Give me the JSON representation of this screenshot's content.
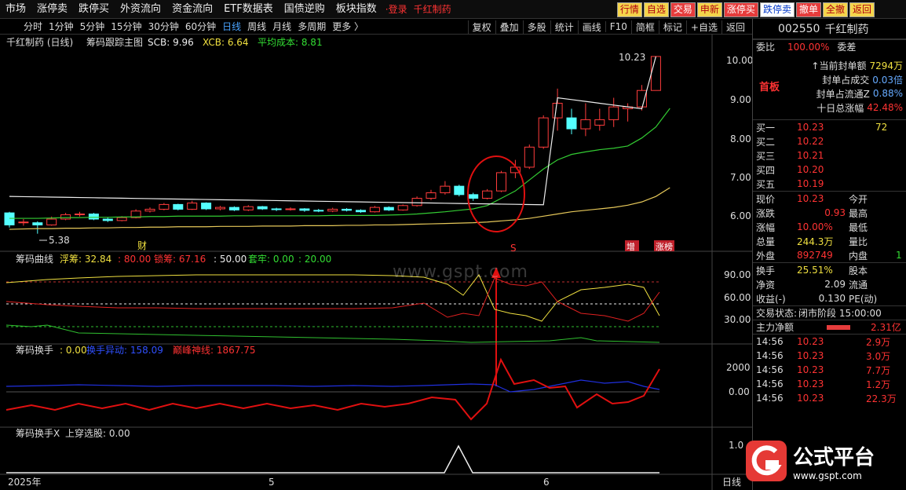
{
  "menubar": {
    "items": [
      "市场",
      "涨停卖",
      "跌停买",
      "外资流向",
      "资金流向",
      "ETF数据表",
      "国债逆购",
      "板块指数"
    ],
    "login": "·登录",
    "stock_name": "千红制药",
    "buttons": [
      "行情",
      "自选",
      "交易",
      "申新",
      "涨停买",
      "跌停卖",
      "撤单",
      "全撤",
      "返回"
    ]
  },
  "periodbar": {
    "periods": [
      "分时",
      "1分钟",
      "5分钟",
      "15分钟",
      "30分钟",
      "60分钟",
      "日线",
      "周线",
      "月线",
      "多周期",
      "更多 〉"
    ],
    "active": "日线",
    "tools": [
      "复权",
      "叠加",
      "多股",
      "统计",
      "画线",
      "F10",
      "简框",
      "标记",
      "+自选",
      "返回"
    ]
  },
  "main_panel": {
    "title": "千红制药 (日线)",
    "indicator_name": "筹码跟踪主图",
    "scb": "SCB: 9.96",
    "xcb": "XCB: 6.64",
    "avg_cost": "平均成本: 8.81",
    "high_label": "10.23",
    "low_label": "5.38",
    "y_ticks": [
      "10.00",
      "9.00",
      "8.00",
      "7.00",
      "6.00"
    ],
    "marker_cai": "财",
    "marker_s": "S",
    "marker_zeng": "增",
    "marker_zhangbang": "涨榜"
  },
  "panel2": {
    "name": "筹码曲线",
    "fuchou": "浮筹: 32.84",
    "v80": ": 80.00",
    "suochou": "锁筹: 67.16",
    "v50": ": 50.00",
    "taolao": "套牢: 0.00",
    "v20": ": 20.00",
    "y_ticks": [
      "90.00",
      "60.00",
      "30.00"
    ]
  },
  "panel3": {
    "name": "筹码换手",
    "v0": ": 0.00",
    "huanshou": "换手异动: 158.09",
    "dianfeng": "巅峰神线: 1867.75",
    "y_ticks": [
      "2000",
      "0.00"
    ]
  },
  "panel4": {
    "name": "筹码换手X",
    "shangchuan": "上穿选股: 0.00",
    "y_ticks": [
      "1.0"
    ]
  },
  "x_axis": {
    "labels": [
      "2025年",
      "5",
      "6"
    ],
    "period": "日线"
  },
  "watermark": "www.gspt.com",
  "right_panel": {
    "code": "002550",
    "name": "千红制药",
    "weibi_label": "委比",
    "weibi": "100.00%",
    "weicha_label": "委差",
    "shouban": "首板",
    "fengdan_label": "↑当前封单额",
    "fengdan": "7294万",
    "fengdan_cj_label": "封单占成交",
    "fengdan_cj": "0.03倍",
    "fengdan_lt_label": "封单占流通Z",
    "fengdan_lt": "0.88%",
    "shiri_label": "十日总涨幅",
    "shiri": "42.48%",
    "bids": [
      {
        "label": "买一",
        "price": "10.23",
        "vol": "72"
      },
      {
        "label": "买二",
        "price": "10.22",
        "vol": ""
      },
      {
        "label": "买三",
        "price": "10.21",
        "vol": ""
      },
      {
        "label": "买四",
        "price": "10.20",
        "vol": ""
      },
      {
        "label": "买五",
        "price": "10.19",
        "vol": ""
      }
    ],
    "quote": [
      {
        "l1": "现价",
        "v1": "10.23",
        "l2": "今开",
        "v2": ""
      },
      {
        "l1": "涨跌",
        "v1": "0.93",
        "l2": "最高",
        "v2": ""
      },
      {
        "l1": "涨幅",
        "v1": "10.00%",
        "l2": "最低",
        "v2": ""
      },
      {
        "l1": "总量",
        "v1": "244.3万",
        "l2": "量比",
        "v2": ""
      },
      {
        "l1": "外盘",
        "v1": "892749",
        "l2": "内盘",
        "v2": "1"
      }
    ],
    "quote2": [
      {
        "l1": "换手",
        "v1": "25.51%",
        "l2": "股本"
      },
      {
        "l1": "净资",
        "v1": "2.09",
        "l2": "流通"
      },
      {
        "l1": "收益(-)",
        "v1": "0.130",
        "l2": "PE(动)"
      }
    ],
    "status_label": "交易状态:",
    "status": "闭市阶段 15:00:00",
    "zhuli_label": "主力净额",
    "zhuli": "2.31亿",
    "ticks": [
      {
        "time": "14:56",
        "price": "10.23",
        "vol": "2.9万"
      },
      {
        "time": "14:56",
        "price": "10.23",
        "vol": "3.0万"
      },
      {
        "time": "14:56",
        "price": "10.23",
        "vol": "7.7万"
      },
      {
        "time": "14:56",
        "price": "10.23",
        "vol": "1.2万"
      },
      {
        "time": "14:56",
        "price": "10.23",
        "vol": "22.3万"
      }
    ]
  },
  "logo": {
    "name": "公式平台",
    "url": "www.gspt.com"
  },
  "chart_data": {
    "type": "candlestick",
    "price_range": [
      5.2,
      10.4
    ],
    "candles": [
      {
        "o": 5.95,
        "c": 5.62,
        "h": 5.98,
        "l": 5.55
      },
      {
        "o": 5.68,
        "c": 5.7,
        "h": 5.78,
        "l": 5.6
      },
      {
        "o": 5.68,
        "c": 5.62,
        "h": 5.72,
        "l": 5.38
      },
      {
        "o": 5.62,
        "c": 5.78,
        "h": 5.85,
        "l": 5.6
      },
      {
        "o": 5.78,
        "c": 5.9,
        "h": 5.95,
        "l": 5.75
      },
      {
        "o": 5.9,
        "c": 5.92,
        "h": 5.98,
        "l": 5.85
      },
      {
        "o": 5.92,
        "c": 5.78,
        "h": 5.95,
        "l": 5.75
      },
      {
        "o": 5.78,
        "c": 5.74,
        "h": 5.82,
        "l": 5.7
      },
      {
        "o": 5.74,
        "c": 5.82,
        "h": 5.86,
        "l": 5.72
      },
      {
        "o": 5.82,
        "c": 6.0,
        "h": 6.05,
        "l": 5.8
      },
      {
        "o": 6.0,
        "c": 6.05,
        "h": 6.1,
        "l": 5.96
      },
      {
        "o": 6.05,
        "c": 6.18,
        "h": 6.22,
        "l": 6.02
      },
      {
        "o": 6.18,
        "c": 6.05,
        "h": 6.2,
        "l": 6.02
      },
      {
        "o": 6.05,
        "c": 6.22,
        "h": 6.28,
        "l": 6.03
      },
      {
        "o": 6.22,
        "c": 6.06,
        "h": 6.24,
        "l": 6.03
      },
      {
        "o": 6.06,
        "c": 6.1,
        "h": 6.14,
        "l": 6.02
      },
      {
        "o": 6.1,
        "c": 6.03,
        "h": 6.13,
        "l": 6.0
      },
      {
        "o": 6.03,
        "c": 6.12,
        "h": 6.16,
        "l": 6.0
      },
      {
        "o": 6.12,
        "c": 6.06,
        "h": 6.14,
        "l": 6.03
      },
      {
        "o": 6.06,
        "c": 6.04,
        "h": 6.09,
        "l": 6.0
      },
      {
        "o": 6.04,
        "c": 6.06,
        "h": 6.1,
        "l": 6.01
      },
      {
        "o": 6.06,
        "c": 6.02,
        "h": 6.08,
        "l": 5.98
      },
      {
        "o": 6.02,
        "c": 6.0,
        "h": 6.06,
        "l": 5.97
      },
      {
        "o": 6.0,
        "c": 6.05,
        "h": 6.09,
        "l": 5.97
      },
      {
        "o": 6.05,
        "c": 6.02,
        "h": 6.08,
        "l": 5.99
      },
      {
        "o": 6.02,
        "c": 5.98,
        "h": 6.05,
        "l": 5.95
      },
      {
        "o": 5.98,
        "c": 6.1,
        "h": 6.14,
        "l": 5.96
      },
      {
        "o": 6.1,
        "c": 6.03,
        "h": 6.13,
        "l": 6.0
      },
      {
        "o": 6.03,
        "c": 6.15,
        "h": 6.18,
        "l": 6.01
      },
      {
        "o": 6.15,
        "c": 6.35,
        "h": 6.4,
        "l": 6.12
      },
      {
        "o": 6.35,
        "c": 6.5,
        "h": 6.58,
        "l": 6.3
      },
      {
        "o": 6.5,
        "c": 6.68,
        "h": 6.82,
        "l": 6.45
      },
      {
        "o": 6.68,
        "c": 6.45,
        "h": 6.72,
        "l": 6.4
      },
      {
        "o": 6.45,
        "c": 6.35,
        "h": 6.5,
        "l": 6.28
      },
      {
        "o": 6.35,
        "c": 6.55,
        "h": 6.6,
        "l": 6.32
      },
      {
        "o": 6.55,
        "c": 7.05,
        "h": 7.1,
        "l": 6.52
      },
      {
        "o": 7.05,
        "c": 7.2,
        "h": 7.4,
        "l": 6.9
      },
      {
        "o": 7.2,
        "c": 7.75,
        "h": 7.82,
        "l": 7.15
      },
      {
        "o": 7.75,
        "c": 8.55,
        "h": 8.62,
        "l": 7.7
      },
      {
        "o": 8.55,
        "c": 8.95,
        "h": 9.35,
        "l": 8.2
      },
      {
        "o": 8.55,
        "c": 8.25,
        "h": 8.8,
        "l": 8.1
      },
      {
        "o": 8.25,
        "c": 8.5,
        "h": 8.95,
        "l": 8.05
      },
      {
        "o": 8.35,
        "c": 8.5,
        "h": 8.8,
        "l": 8.2
      },
      {
        "o": 8.5,
        "c": 8.85,
        "h": 9.1,
        "l": 8.3
      },
      {
        "o": 8.8,
        "c": 8.85,
        "h": 8.95,
        "l": 8.45
      },
      {
        "o": 8.85,
        "c": 9.3,
        "h": 9.45,
        "l": 8.75
      },
      {
        "o": 9.3,
        "c": 10.23,
        "h": 10.23,
        "l": 9.5
      }
    ],
    "avg_cost_line": [
      5.8,
      5.8,
      5.8,
      5.81,
      5.82,
      5.82,
      5.83,
      5.83,
      5.84,
      5.84,
      5.85,
      5.85,
      5.86,
      5.86,
      5.86,
      5.86,
      5.87,
      5.87,
      5.87,
      5.87,
      5.87,
      5.87,
      5.87,
      5.88,
      5.88,
      5.88,
      5.88,
      5.89,
      5.9,
      5.92,
      5.95,
      5.98,
      6.02,
      6.06,
      6.15,
      6.35,
      6.55,
      6.85,
      7.15,
      7.4,
      7.55,
      7.62,
      7.68,
      7.72,
      7.78,
      8.0,
      8.3,
      8.81
    ],
    "scb_line_start": 6.4,
    "xcb_line": [
      5.5,
      5.51,
      5.52,
      5.52,
      5.53,
      5.53,
      5.54,
      5.54,
      5.55,
      5.55,
      5.56,
      5.56,
      5.57,
      5.57,
      5.57,
      5.58,
      5.58,
      5.58,
      5.59,
      5.59,
      5.59,
      5.6,
      5.6,
      5.6,
      5.61,
      5.61,
      5.62,
      5.62,
      5.63,
      5.64,
      5.65,
      5.66,
      5.67,
      5.68,
      5.7,
      5.73,
      5.76,
      5.8,
      5.86,
      5.92,
      5.98,
      6.02,
      6.06,
      6.1,
      6.16,
      6.25,
      6.4,
      6.64
    ]
  }
}
